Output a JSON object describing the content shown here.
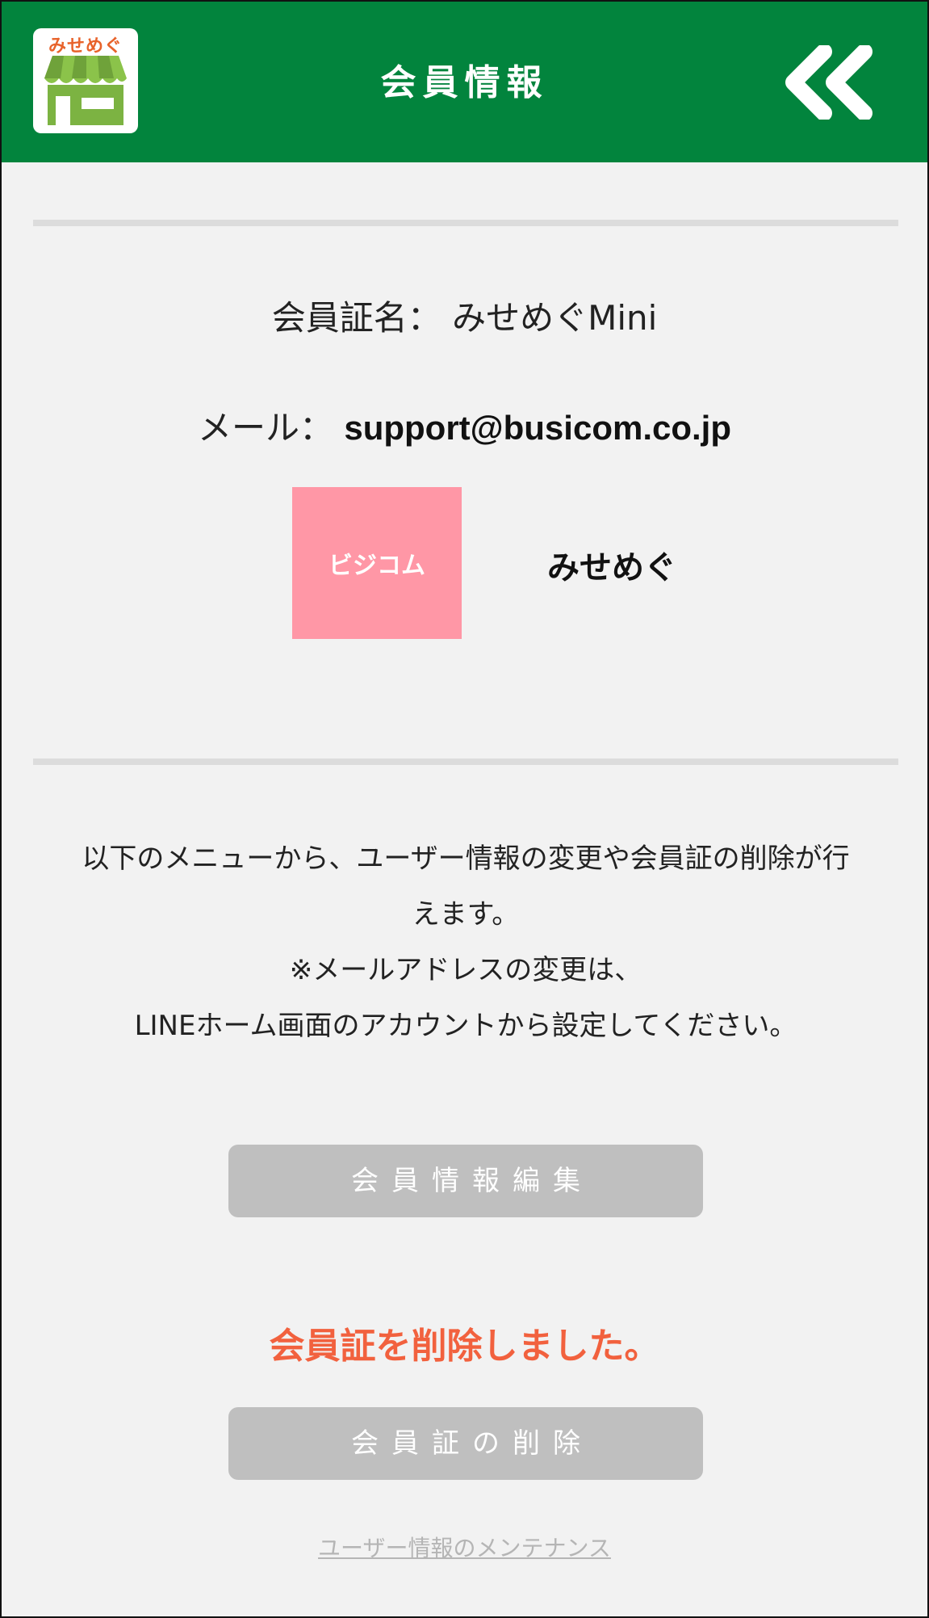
{
  "header": {
    "logo_text": "みせめぐ",
    "title": "会員情報"
  },
  "member": {
    "card_name_label": "会員証名：",
    "card_name_value": "みせめぐMini",
    "mail_label": "メール：",
    "mail_value": "support@busicom.co.jp"
  },
  "shop": {
    "logo_text": "ビジコム",
    "logo_color": "#ff97a6",
    "name": "みせめぐ"
  },
  "description": {
    "line1": "以下のメニューから、ユーザー情報の変更や会員証の削除が行",
    "line2": "えます。",
    "line3": "※メールアドレスの変更は、",
    "line4": "LINEホーム画面のアカウントから設定してください。"
  },
  "buttons": {
    "edit_label": "会員情報編集",
    "delete_label": "会員証の削除"
  },
  "status": {
    "message": "会員証を削除しました。",
    "color": "#f2613e"
  },
  "links": {
    "maintenance": "ユーザー情報のメンテナンス"
  },
  "colors": {
    "header_bg": "#02843d",
    "page_bg": "#f2f2f2",
    "button_bg": "#bfbfbf"
  },
  "icons": {
    "app_logo": "storefront-icon",
    "back": "double-chevron-left-icon"
  }
}
